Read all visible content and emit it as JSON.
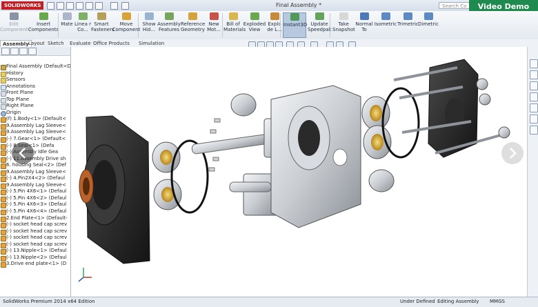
{
  "app": {
    "logo": "SOLIDWORKS",
    "window_title": "Final Assembly *",
    "search_placeholder": "Search Co",
    "video_demo": "Video Demo"
  },
  "ribbon": [
    {
      "label": "Edit Component",
      "disabled": true,
      "color": "#8a94a3"
    },
    {
      "label": "Insert Components",
      "color": "#6aa84f"
    },
    {
      "label": "Mate",
      "color": "#a9b7c9"
    },
    {
      "label": "Linea r Co...",
      "color": "#7fb069"
    },
    {
      "label": "Smart Fasteners",
      "color": "#b5a05b"
    },
    {
      "label": "Move Component",
      "color": "#d8a43a"
    },
    {
      "label": "Show Hid...",
      "color": "#9ab3d0"
    },
    {
      "label": "Assembly Features",
      "color": "#76a55e"
    },
    {
      "label": "Reference Geometry",
      "color": "#d4a33d"
    },
    {
      "label": "New Mot...",
      "color": "#c9524a"
    },
    {
      "label": "Bill of Materials",
      "color": "#d9b64e"
    },
    {
      "label": "Exploded View",
      "color": "#6aa84f"
    },
    {
      "label": "Explo de L...",
      "color": "#c58b3a"
    },
    {
      "label": "Instant3D",
      "color": "#4f9a5b",
      "active": true
    },
    {
      "label": "Update Speedpak",
      "color": "#66a35a"
    },
    {
      "label": "Take Snapshot",
      "color": "#d7d7d7"
    },
    {
      "label": "Normal To",
      "color": "#4e79b8"
    },
    {
      "label": "Isometric",
      "color": "#5d8ac2"
    },
    {
      "label": "Trimetric",
      "color": "#5d8ac2"
    },
    {
      "label": "Dimetric",
      "color": "#5d8ac2"
    }
  ],
  "tabs": [
    "Assembly",
    "Layout",
    "Sketch",
    "Evaluate",
    "Office Products",
    "Simulation"
  ],
  "tree": [
    {
      "label": "Final Assembly  (Default<D",
      "icon": "asm"
    },
    {
      "label": "History",
      "icon": "folder"
    },
    {
      "label": "Sensors",
      "icon": "folder"
    },
    {
      "label": "Annotations",
      "icon": "ann"
    },
    {
      "label": "Front Plane",
      "icon": "plane"
    },
    {
      "label": "Top Plane",
      "icon": "plane"
    },
    {
      "label": "Right Plane",
      "icon": "plane"
    },
    {
      "label": "Origin",
      "icon": "orig"
    },
    {
      "label": "(f) 1.Body<1> (Default<",
      "icon": "part"
    },
    {
      "label": "9.Assembly Lag Sleeve<",
      "icon": "part"
    },
    {
      "label": "9.Assembly Lag Sleeve<",
      "icon": "part"
    },
    {
      "label": "(-) 7.Gear<1> (Default<",
      "icon": "part"
    },
    {
      "label": "(-) 8.Seal<1> (Defa",
      "icon": "part"
    },
    {
      "label": "(-) Assembly Idle Gea",
      "icon": "part"
    },
    {
      "label": "(-) 11.Assembly Drive sh",
      "icon": "part"
    },
    {
      "label": "6. housing Seal<2> (Def",
      "icon": "part"
    },
    {
      "label": "9.Assembly Lag Sleeve<",
      "icon": "part"
    },
    {
      "label": "(-) 4.Pin2X4<2> (Defaul",
      "icon": "part"
    },
    {
      "label": "9.Assembly Lag Sleeve<",
      "icon": "part"
    },
    {
      "label": "(-) 5.Pin 4X6<1> (Defaul",
      "icon": "part"
    },
    {
      "label": "(-) 5.Pin 4X6<2> (Defaul",
      "icon": "part"
    },
    {
      "label": "(-) 5.Pin 4X6<3> (Defaul",
      "icon": "part"
    },
    {
      "label": "(-) 5.Pin 4X6<4> (Defaul",
      "icon": "part"
    },
    {
      "label": "2.End Plate<1> (Default-",
      "icon": "part"
    },
    {
      "label": "(-) socket head cap screv",
      "icon": "part"
    },
    {
      "label": "(-) socket head cap screv",
      "icon": "part"
    },
    {
      "label": "(-) socket head cap screv",
      "icon": "part"
    },
    {
      "label": "(-) socket head cap screv",
      "icon": "part"
    },
    {
      "label": "(-) 13.Nipple<1> (Defaul",
      "icon": "part"
    },
    {
      "label": "(-) 13.Nipple<2> (Defaul",
      "icon": "part"
    },
    {
      "label": "3.Drive end plate<1> (D",
      "icon": "part"
    }
  ],
  "status": {
    "edition": "SolidWorks Premium 2014 x64 Edition",
    "state": "Under Defined",
    "mode": "Editing Assembly",
    "units": "MMGS"
  },
  "colors": {
    "video_demo": "#1e8a4d",
    "part_dark": "#2a2a2a",
    "bronze": "#b8632c",
    "brass": "#d6a52c",
    "steel": "#c9cdd2"
  }
}
